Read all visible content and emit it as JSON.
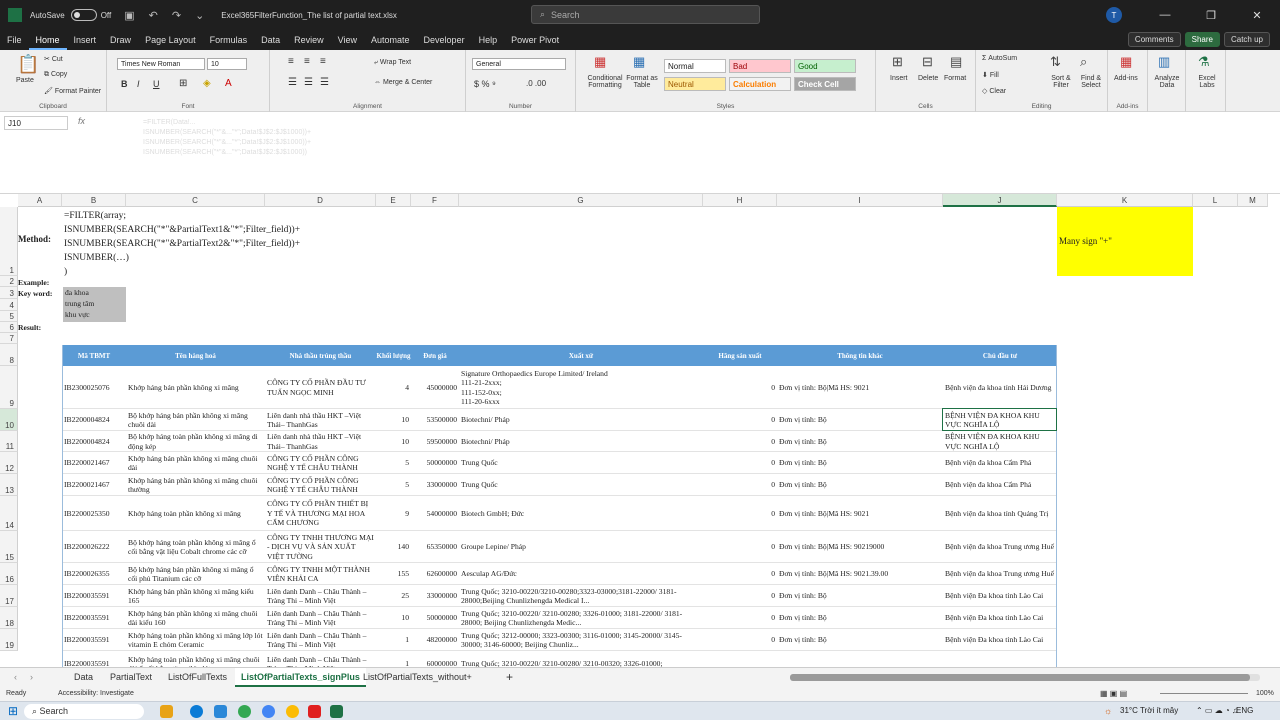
{
  "titlebar": {
    "autosave": "AutoSave",
    "toggle": "Off",
    "filename": "Excel365FilterFunction_The list of partial text.xlsx",
    "search": "Search",
    "avatar": "T"
  },
  "menu": {
    "tabs": [
      "File",
      "Home",
      "Insert",
      "Draw",
      "Page Layout",
      "Formulas",
      "Data",
      "Review",
      "View",
      "Automate",
      "Developer",
      "Help",
      "Power Pivot"
    ],
    "comments": "Comments",
    "share": "Share",
    "catchup": "Catch up"
  },
  "ribbon": {
    "paste": "Paste",
    "cut": "Cut",
    "copy": "Copy",
    "format_painter": "Format Painter",
    "clipboard": "Clipboard",
    "font_name": "Times New Roman",
    "font_size": "10",
    "font": "Font",
    "wrap": "Wrap Text",
    "merge": "Merge & Center",
    "alignment": "Alignment",
    "number_format": "General",
    "number": "Number",
    "cond_fmt": "Conditional Formatting",
    "fmt_table": "Format as Table",
    "styles": [
      "Normal",
      "Bad",
      "Good",
      "Neutral",
      "Calculation",
      "Check Cell"
    ],
    "styles_label": "Styles",
    "insert": "Insert",
    "delete": "Delete",
    "format": "Format",
    "cells": "Cells",
    "autosum": "AutoSum",
    "fill": "Fill",
    "clear": "Clear",
    "sort": "Sort & Filter",
    "find": "Find & Select",
    "editing": "Editing",
    "addins": "Add-ins",
    "analyze": "Analyze Data",
    "excel_labs": "Excel Labs"
  },
  "formula": {
    "namebox": "J10",
    "fx": "fx",
    "lines": [
      "=FILTER(Data!...",
      "ISNUMBER(SEARCH(\"*\"&...\"*\";Data!$J$2:$J$1000))+",
      "ISNUMBER(SEARCH(\"*\"&...\"*\";Data!$J$2:$J$1000))+",
      "ISNUMBER(SEARCH(\"*\"&...\"*\";Data!$J$2:$J$1000))"
    ]
  },
  "columns": [
    "A",
    "B",
    "C",
    "D",
    "E",
    "F",
    "G",
    "H",
    "I",
    "J",
    "K",
    "L",
    "M"
  ],
  "rows": [
    "1",
    "2",
    "3",
    "4",
    "5",
    "6",
    "7",
    "8",
    "9",
    "10",
    "11",
    "12",
    "13",
    "14",
    "15",
    "16",
    "17",
    "18",
    "19",
    "20"
  ],
  "sheet": {
    "method_label": "Method:",
    "method_lines": [
      "=FILTER(array;",
      "ISNUMBER(SEARCH(\"*\"&PartialText1&\"*\";Filter_field))+",
      "ISNUMBER(SEARCH(\"*\"&PartialText2&\"*\";Filter_field))+",
      "ISNUMBER(…)",
      ")"
    ],
    "many_sign": "Many sign \"+\"",
    "example": "Example:",
    "keyword": "Key word:",
    "keywords": [
      "đa khoa",
      "trung tâm",
      "khu vực"
    ],
    "result": "Result:",
    "headers": [
      "Mã TBMT",
      "Tên hàng hoá",
      "Nhà thầu trúng thầu",
      "Khối lượng",
      "Đơn giá",
      "Xuất xứ",
      "Hãng sản xuất",
      "Thông tin khác",
      "Chủ đầu tư"
    ],
    "data": [
      [
        "IB2300025076",
        "Khớp háng bán phần không xi măng",
        "CÔNG TY CỔ PHẦN ĐẦU TƯ TUẤN NGỌC MINH",
        "4",
        "45000000",
        "Signature Orthopaedics Europe Limited/ Ireland\n111-21-2xxx;\n111-152-0xx;\n111-20-6xxx",
        "0",
        "Đơn vị tính: Bộ|Mã HS: 9021",
        "Bệnh viện đa khoa tỉnh Hải Dương"
      ],
      [
        "IB2200004824",
        "Bộ khớp háng bán phần không xi măng chuôi dài",
        "Liên danh nhà thầu HKT –Việt Thái– ThanhGas",
        "10",
        "53500000",
        "Biotechni/ Pháp",
        "0",
        "Đơn vị tính: Bộ",
        "BỆNH VIỆN ĐA KHOA KHU VỰC NGHĨA LỘ"
      ],
      [
        "IB2200004824",
        "Bộ khớp háng toàn phần không xi măng di động kép",
        "Liên danh nhà thầu HKT –Việt Thái– ThanhGas",
        "10",
        "59500000",
        "Biotechni/ Pháp",
        "0",
        "Đơn vị tính: Bộ",
        "BỆNH VIỆN ĐA KHOA KHU VỰC NGHĨA LỘ"
      ],
      [
        "IB2200021467",
        "Khớp háng bán phần không xi măng chuôi dài",
        "CÔNG TY CỔ PHẦN CÔNG NGHỆ Y TẾ CHÂU THÀNH",
        "5",
        "50000000",
        "Trung Quốc",
        "0",
        "Đơn vị tính: Bộ",
        "Bệnh viện đa khoa Cẩm Phả"
      ],
      [
        "IB2200021467",
        "Khớp háng bán phần không xi măng chuôi thường",
        "CÔNG TY CỔ PHẦN CÔNG NGHỆ Y TẾ CHÂU THÀNH",
        "5",
        "33000000",
        "Trung Quốc",
        "0",
        "Đơn vị tính: Bộ",
        "Bệnh viện đa khoa Cẩm Phả"
      ],
      [
        "IB2200025350",
        "Khớp háng toàn  phần không xi măng",
        "CÔNG TY CỔ PHẦN THIẾT BỊ Y TẾ VÀ THƯƠNG MẠI HOA CẨM CHƯƠNG",
        "9",
        "54000000",
        "Biotech GmbH; Đức",
        "0",
        "Đơn vị tính: Bộ|Mã HS: 9021",
        "Bệnh viện đa khoa tỉnh Quảng Trị"
      ],
      [
        "IB2200026222",
        "Bộ khớp háng toàn phần không xi măng ổ cối bằng vật liệu Cobalt chrome các cỡ",
        "CÔNG TY TNHH THƯƠNG MẠI - DỊCH VỤ VÀ SẢN XUẤT VIỆT TƯỜNG",
        "140",
        "65350000",
        "Groupe Lepine/ Pháp",
        "0",
        "Đơn vị tính: Bộ|Mã HS: 90219000",
        "Bệnh viện đa khoa Trung ương Huế"
      ],
      [
        "IB2200026355",
        "Bộ khớp háng bán phần không xi măng ổ cối phủ Titanium các cỡ",
        "CÔNG TY TNHH MỘT THÀNH VIÊN KHẢI CA",
        "155",
        "62600000",
        "Aesculap AG/Đức",
        "0",
        "Đơn vị tính: Bộ|Mã HS: 9021.39.00",
        "Bệnh viện đa khoa Trung ương Huế"
      ],
      [
        "IB2200035591",
        "Khớp háng bán phần không xi măng kiểu 165",
        "Liên danh Danh – Châu Thành – Tràng Thi – Minh Việt",
        "25",
        "33000000",
        "Trung Quốc; 3210-00220/3210-00280;3323-03000;3181-22000/ 3181-28000;Beijing Chunlizhengda Medical I...",
        "0",
        "Đơn vị tính: Bộ",
        "Bệnh viện Đa khoa tỉnh Lào Cai"
      ],
      [
        "IB2200035591",
        "Khớp háng bán phần không xi măng chuôi dài kiểu 160",
        "Liên danh Danh – Châu Thành – Tràng Thi – Minh Việt",
        "10",
        "50000000",
        "Trung Quốc; 3210-00220/ 3210-00280; 3326-01000; 3181-22000/ 3181-28000; Beijing Chunlizhengda Medic...",
        "0",
        "Đơn vị tính: Bộ",
        "Bệnh viện Đa khoa tỉnh Lào Cai"
      ],
      [
        "IB2200035591",
        "Khớp háng toàn phần không xi măng lớp lót vitamin E chỏm Ceramic",
        "Liên danh Danh – Châu Thành – Tràng Thi – Minh Việt",
        "1",
        "48200000",
        "Trung Quốc; 3212-00000; 3323-00300; 3116-01000; 3145-20000/ 3145-30000; 3146-60000; Beijing Chunliz...",
        "0",
        "Đơn vị tính: Bộ",
        "Bệnh viện Đa khoa tỉnh Lào Cai"
      ],
      [
        "IB2200035591",
        "Khớp háng toàn phần không xi măng chuôi dài ổ cối bằng titan (lớp lót...",
        "Liên danh Danh – Châu Thành – Tràng Thi – Minh Việt",
        "1",
        "60000000",
        "Trung Quốc; 3210-00220/ 3210-00280/ 3210-00320; 3326-01000;",
        "",
        "",
        ""
      ]
    ]
  },
  "tabs": [
    "Data",
    "PartialText",
    "ListOfFullTexts",
    "ListOfPartialTexts_signPlus",
    "ListOfPartialTexts_without+"
  ],
  "status": {
    "ready": "Ready",
    "accessibility": "Accessibility: Investigate",
    "zoom": "100%"
  },
  "taskbar": {
    "search": "Search",
    "weather": "31°C  Trời ít mây",
    "lang": "ENG"
  },
  "colors": {
    "header_blue": "#5b9bd5",
    "yellow": "#ffff00",
    "keyword_gray": "#bfbfbf",
    "excel_green": "#1e7145"
  }
}
